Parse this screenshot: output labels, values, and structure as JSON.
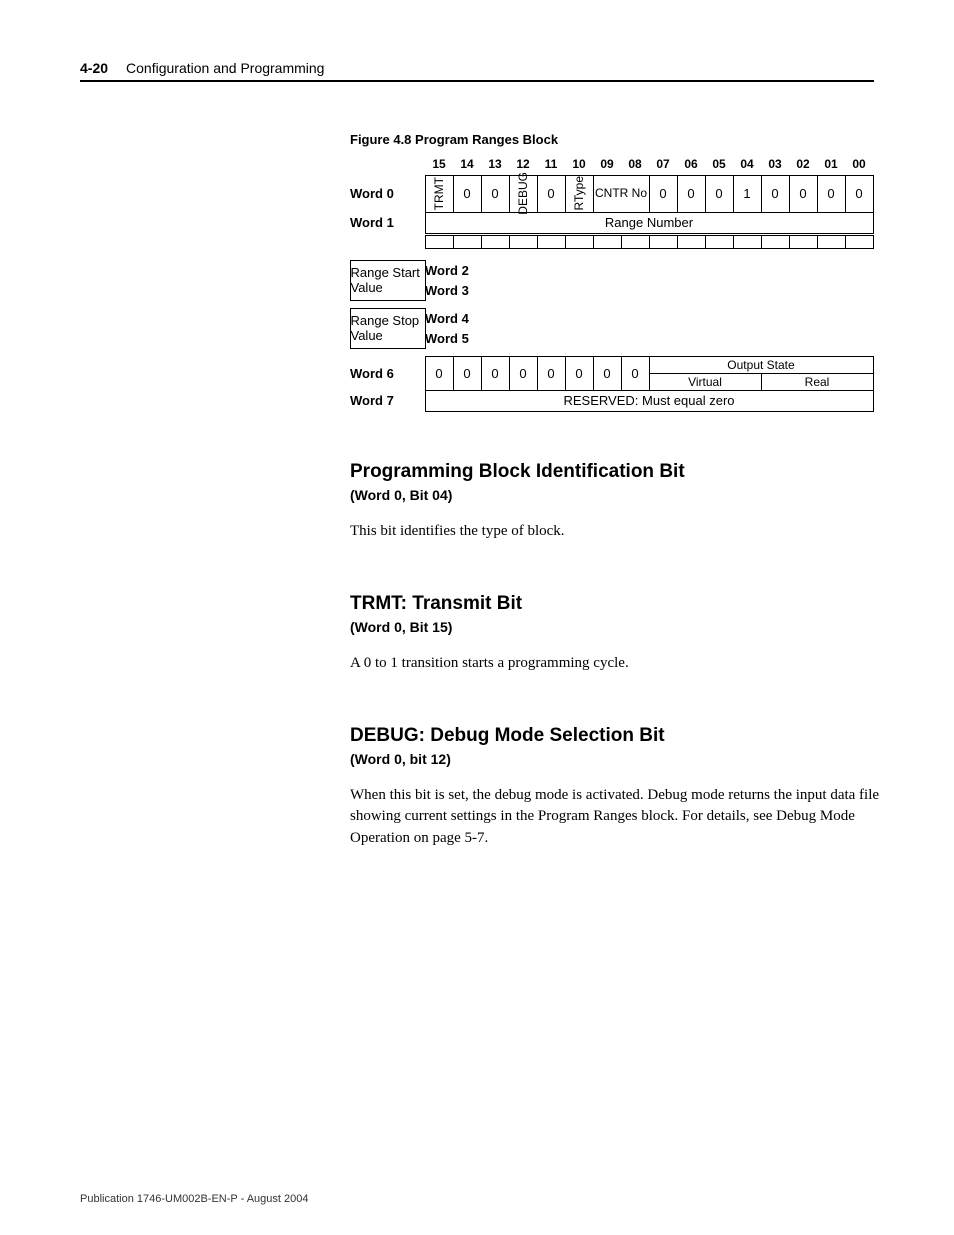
{
  "header": {
    "page_number": "4-20",
    "chapter_title": "Configuration and Programming"
  },
  "figure": {
    "caption": "Figure 4.8 Program Ranges Block",
    "bit_numbers": [
      "15",
      "14",
      "13",
      "12",
      "11",
      "10",
      "09",
      "08",
      "07",
      "06",
      "05",
      "04",
      "03",
      "02",
      "01",
      "00"
    ],
    "word_labels": [
      "Word 0",
      "Word 1",
      "Word 2",
      "Word 3",
      "Word 4",
      "Word 5",
      "Word 6",
      "Word 7"
    ],
    "word0": {
      "b15": "TRMT",
      "b14": "0",
      "b13": "0",
      "b12": "DEBUG",
      "b11": "0",
      "b10": "RType",
      "b09_08": "CNTR No",
      "b07": "0",
      "b06": "0",
      "b05": "0",
      "b04": "1",
      "b03": "0",
      "b02": "0",
      "b01": "0",
      "b00": "0"
    },
    "word1": "Range Number",
    "word23": "Range Start Value",
    "word45": "Range Stop Value",
    "word6": {
      "zeros": [
        "0",
        "0",
        "0",
        "0",
        "0",
        "0",
        "0",
        "0"
      ],
      "output_state": "Output State",
      "virtual": "Virtual",
      "real": "Real"
    },
    "word7": "RESERVED: Must equal zero"
  },
  "sections": [
    {
      "heading": "Programming Block Identification Bit",
      "sub": "(Word 0, Bit 04)",
      "body": "This bit identifies the type of block."
    },
    {
      "heading": "TRMT: Transmit Bit",
      "sub": "(Word 0, Bit 15)",
      "body": "A 0 to 1 transition starts a programming cycle."
    },
    {
      "heading": "DEBUG: Debug Mode Selection Bit",
      "sub": "(Word 0, bit 12)",
      "body": "When this bit is set, the debug mode is activated. Debug mode returns the input data file showing current settings in the Program Ranges block. For details, see Debug Mode Operation on page 5-7."
    }
  ],
  "footer": "Publication 1746-UM002B-EN-P - August 2004"
}
